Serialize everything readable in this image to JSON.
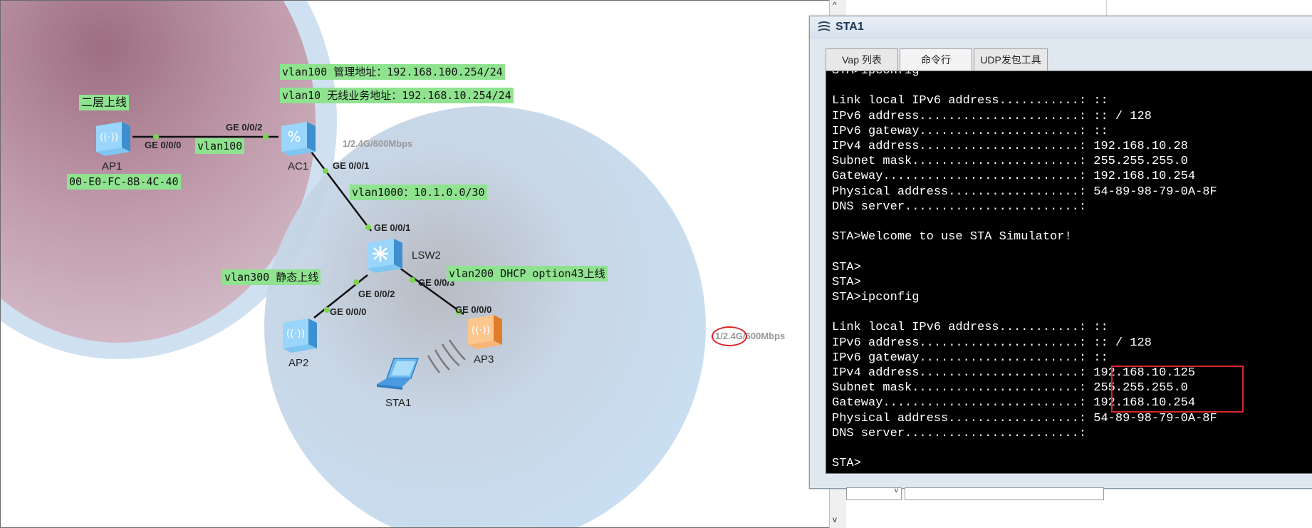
{
  "window": {
    "title": "STA1",
    "tabs": [
      "Vap 列表",
      "命令行",
      "UDP发包工具"
    ]
  },
  "terminal": {
    "lines": [
      "STA>ipconfig",
      "",
      "Link local IPv6 address...........: ::",
      "IPv6 address......................: :: / 128",
      "IPv6 gateway......................: ::",
      "IPv4 address......................: 192.168.10.28",
      "Subnet mask.......................: 255.255.255.0",
      "Gateway...........................: 192.168.10.254",
      "Physical address..................: 54-89-98-79-0A-8F",
      "DNS server........................:",
      "",
      "STA>Welcome to use STA Simulator!",
      "",
      "STA>",
      "STA>",
      "STA>ipconfig",
      "",
      "Link local IPv6 address...........: ::",
      "IPv6 address......................: :: / 128",
      "IPv6 gateway......................: ::",
      "IPv4 address......................: 192.168.10.125",
      "Subnet mask.......................: 255.255.255.0",
      "Gateway...........................: 192.168.10.254",
      "Physical address..................: 54-89-98-79-0A-8F",
      "DNS server........................:",
      "",
      "STA>"
    ]
  },
  "topology": {
    "notes": {
      "vlan100_mgmt": "vlan100 管理地址：192.168.100.254/24",
      "vlan10_wireless": "vlan10 无线业务地址：192.168.10.254/24",
      "l2_online": "二层上线",
      "ap1_mac": "00-E0-FC-8B-4C-40",
      "vlan100": "vlan100",
      "vlan1000": "vlan1000：10.1.0.0/30",
      "vlan300": "vlan300 静态上线",
      "vlan200": "vlan200 DHCP option43上线"
    },
    "devices": {
      "ap1": "AP1",
      "ac1": "AC1",
      "lsw2": "LSW2",
      "ap2": "AP2",
      "ap3": "AP3",
      "sta1": "STA1"
    },
    "ports": {
      "ap1_ge000": "GE 0/0/0",
      "ac1_ge002": "GE 0/0/2",
      "ac1_ge001": "GE 0/0/1",
      "lsw2_ge001": "GE 0/0/1",
      "lsw2_ge002": "GE 0/0/2",
      "lsw2_ge003": "GE 0/0/3",
      "ap2_ge000": "GE 0/0/0",
      "ap3_ge000": "GE 0/0/0"
    },
    "rates": {
      "r1": "1/2.4G/600Mbps",
      "r2_prefix": "1/2.4G",
      "r2_suffix": "/600Mbps"
    }
  },
  "scroll": {
    "up": "^",
    "down": "v"
  }
}
